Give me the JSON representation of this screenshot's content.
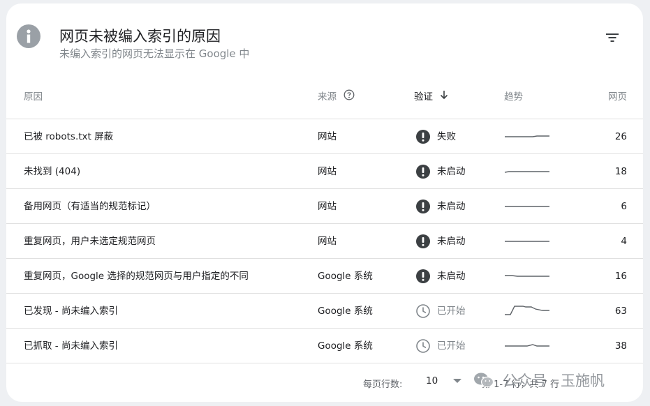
{
  "header": {
    "title": "网页未被编入索引的原因",
    "subtitle": "未编入索引的网页无法显示在 Google 中",
    "info_icon": "info-icon",
    "filter_icon": "filter-icon"
  },
  "columns": {
    "reason": "原因",
    "source": "来源",
    "verify": "验证",
    "trend": "趋势",
    "pages": "网页"
  },
  "rows": [
    {
      "reason": "已被 robots.txt 屏蔽",
      "source": "网站",
      "status": "失败",
      "status_icon": "error-icon",
      "pages": "26"
    },
    {
      "reason": "未找到 (404)",
      "source": "网站",
      "status": "未启动",
      "status_icon": "error-icon",
      "pages": "18"
    },
    {
      "reason": "备用网页（有适当的规范标记）",
      "source": "网站",
      "status": "未启动",
      "status_icon": "error-icon",
      "pages": "6"
    },
    {
      "reason": "重复网页，用户未选定规范网页",
      "source": "网站",
      "status": "未启动",
      "status_icon": "error-icon",
      "pages": "4"
    },
    {
      "reason": "重复网页，Google 选择的规范网页与用户指定的不同",
      "source": "Google 系统",
      "status": "未启动",
      "status_icon": "error-icon",
      "pages": "16"
    },
    {
      "reason": "已发现 - 尚未编入索引",
      "source": "Google 系统",
      "status": "已开始",
      "status_icon": "clock-icon",
      "pages": "63"
    },
    {
      "reason": "已抓取 - 尚未编入索引",
      "source": "Google 系统",
      "status": "已开始",
      "status_icon": "clock-icon",
      "pages": "38"
    }
  ],
  "footer": {
    "rows_per_page_label": "每页行数:",
    "rows_per_page_value": "10",
    "range": "第 1-7 行，共 7 行"
  },
  "watermark": {
    "text": "公众号 · 玉施帆",
    "icon": "wechat-icon"
  },
  "colors": {
    "error_icon": "#3c4043",
    "pending_icon": "#80868b",
    "sparkline": "#5f6368"
  }
}
